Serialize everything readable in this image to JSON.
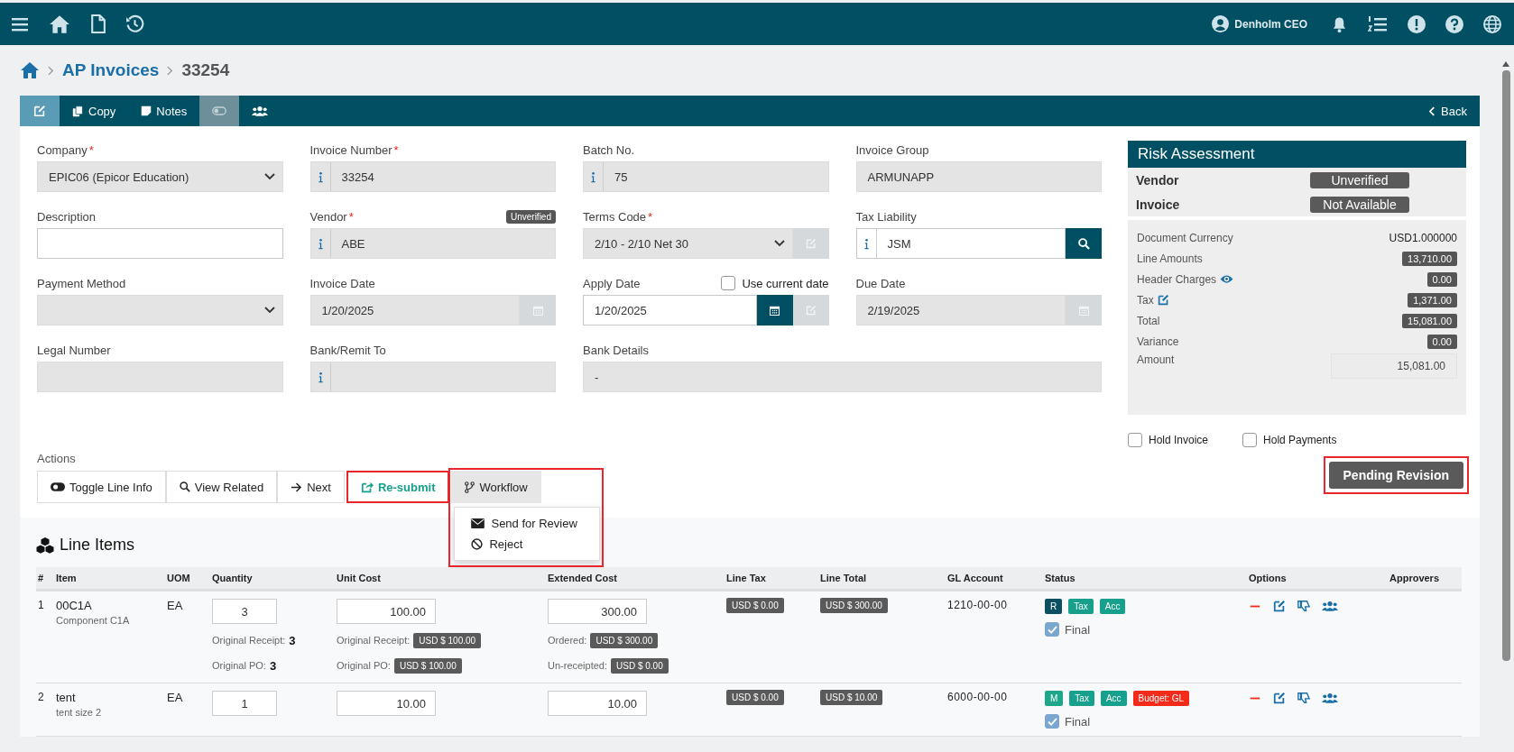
{
  "top_bar": {
    "user": "Denholm CEO"
  },
  "breadcrumb": {
    "section": "AP Invoices",
    "current": "33254"
  },
  "toolbar": {
    "items": [
      {
        "kind": "edit",
        "selected": true,
        "disabled": false
      },
      {
        "kind": "copy",
        "label": "Copy",
        "selected": false,
        "disabled": false
      },
      {
        "kind": "notes",
        "label": "Notes",
        "selected": false,
        "disabled": false
      },
      {
        "kind": "toggle",
        "selected": false,
        "disabled": true
      },
      {
        "kind": "users",
        "selected": false,
        "disabled": false
      }
    ],
    "back": "Back"
  },
  "fields": [
    {
      "kind": "select",
      "label": "Company",
      "required_mark": "*",
      "value": "EPIC06 (Epicor Education)",
      "disabled": true
    },
    {
      "kind": "info",
      "label": "Invoice Number",
      "required_mark": "*",
      "value": "33254",
      "disabled": true
    },
    {
      "kind": "info",
      "label": "Batch No.",
      "value": "75",
      "disabled": true
    },
    {
      "kind": "text",
      "label": "Invoice Group",
      "value": "ARMUNAPP",
      "disabled": true
    },
    {
      "kind": "text",
      "label": "Description",
      "disabled": false
    },
    {
      "kind": "info",
      "label": "Vendor",
      "required_mark": "*",
      "value": "ABE",
      "disabled": true,
      "badge": "Unverified"
    },
    {
      "kind": "select",
      "label": "Terms Code",
      "required_mark": "*",
      "value": "2/10 - 2/10 Net 30",
      "disabled": true,
      "edit_button": true
    },
    {
      "kind": "search",
      "label": "Tax Liability",
      "value": "JSM",
      "disabled": false
    },
    {
      "kind": "select",
      "label": "Payment Method",
      "disabled": true
    },
    {
      "kind": "date",
      "label": "Invoice Date",
      "value": "1/20/2025",
      "disabled": true
    },
    {
      "kind": "date",
      "label": "Apply Date",
      "value": "1/20/2025",
      "disabled": false,
      "edit_button": true,
      "option": {
        "label": "Use current date",
        "checked": false
      }
    },
    {
      "kind": "date",
      "label": "Due Date",
      "value": "2/19/2025",
      "disabled": true
    },
    {
      "kind": "text",
      "label": "Legal Number",
      "disabled": true
    },
    {
      "kind": "info",
      "label": "Bank/Remit To",
      "disabled": true
    },
    {
      "kind": "text",
      "label": "Bank Details",
      "value": "-",
      "disabled": true,
      "wide": true
    }
  ],
  "actions": {
    "label": "Actions",
    "buttons": [
      {
        "kind": "toggle",
        "label": "Toggle Line Info",
        "highlighted": false
      },
      {
        "kind": "search",
        "label": "View Related",
        "highlighted": false
      },
      {
        "kind": "next",
        "label": "Next",
        "highlighted": false
      },
      {
        "kind": "resubmit",
        "label": "Re-submit",
        "highlighted": true
      },
      {
        "kind": "workflow",
        "label": "Workflow",
        "highlighted": true,
        "expanded": true,
        "menu": [
          {
            "kind": "mail",
            "label": "Send for Review"
          },
          {
            "kind": "reject",
            "label": "Reject"
          }
        ]
      }
    ]
  },
  "risk_assessment": {
    "title": "Risk Assessment",
    "rows": [
      {
        "label": "Vendor",
        "status": "Unverified"
      },
      {
        "label": "Invoice",
        "status": "Not Available"
      }
    ]
  },
  "totals": [
    {
      "kind": "plain",
      "label": "Document Currency",
      "value": "USD1.000000"
    },
    {
      "kind": "badge",
      "label": "Line Amounts",
      "value": "13,710.00"
    },
    {
      "kind": "badge",
      "label": "Header Charges",
      "value": "0.00"
    },
    {
      "kind": "badge",
      "label": "Tax",
      "value": "1,371.00"
    },
    {
      "kind": "badge",
      "label": "Total",
      "value": "15,081.00"
    },
    {
      "kind": "badge",
      "label": "Variance",
      "value": "0.00"
    },
    {
      "kind": "input",
      "label": "Amount",
      "value": "15,081.00"
    }
  ],
  "holds": [
    {
      "label": "Hold Invoice",
      "checked": false
    },
    {
      "label": "Hold Payments",
      "checked": false
    }
  ],
  "status_button": {
    "label": "Pending Revision",
    "highlighted": true
  },
  "line_items": {
    "title": "Line Items",
    "columns": [
      "#",
      "Item",
      "UOM",
      "Quantity",
      "Unit Cost",
      "Extended Cost",
      "Line Tax",
      "Line Total",
      "GL Account",
      "Status",
      "Options",
      "Approvers"
    ],
    "rows": [
      {
        "number": "1",
        "item": "00C1A",
        "description": "Component C1A",
        "uom": "EA",
        "quantity": "3",
        "unit_cost": "100.00",
        "extended_cost": "300.00",
        "line_tax": "USD $ 0.00",
        "line_total": "USD $ 300.00",
        "gl_account": "1210-00-00",
        "tags": [
          {
            "label": "R",
            "color": "#0b4f62"
          },
          {
            "label": "Tax",
            "color": "#17a08b"
          },
          {
            "label": "Acc",
            "color": "#17a08b"
          }
        ],
        "final": {
          "label": "Final",
          "checked": true
        },
        "quantity_notes": [
          {
            "label": "Original Receipt:",
            "value": "3"
          },
          {
            "label": "Original PO:",
            "value": "3"
          }
        ],
        "unit_cost_notes": [
          {
            "label": "Original Receipt:",
            "value": "USD $ 100.00"
          },
          {
            "label": "Original PO:",
            "value": "USD $ 100.00"
          }
        ],
        "extended_cost_notes": [
          {
            "label": "Ordered:",
            "value": "USD $ 300.00"
          },
          {
            "label": "Un-receipted:",
            "value": "USD $ 0.00"
          }
        ]
      },
      {
        "number": "2",
        "item": "tent",
        "description": "tent size 2",
        "uom": "EA",
        "quantity": "1",
        "unit_cost": "10.00",
        "extended_cost": "10.00",
        "line_tax": "USD $ 0.00",
        "line_total": "USD $ 10.00",
        "gl_account": "6000-00-00",
        "tags": [
          {
            "label": "M",
            "color": "#1fa58a"
          },
          {
            "label": "Tax",
            "color": "#17a08b"
          },
          {
            "label": "Acc",
            "color": "#17a08b"
          },
          {
            "label": "Budget: GL",
            "color": "#f42a1a"
          }
        ],
        "final": {
          "label": "Final",
          "checked": true
        }
      }
    ]
  }
}
